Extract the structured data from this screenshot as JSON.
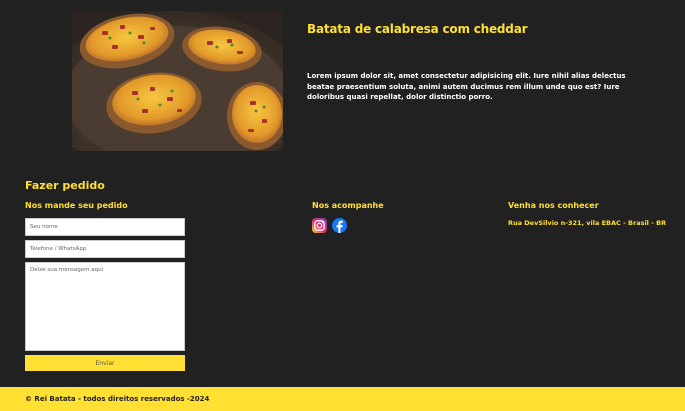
{
  "product": {
    "image_icon": "loaded-potato-photo",
    "title": "Batata de calabresa com cheddar",
    "description": "Lorem ipsum dolor sit, amet consectetur adipisicing elit. Iure nihil alias delectus beatae praesentium soluta, animi autem ducimus rem illum unde quo est? Iure doloribus quasi repellat, dolor distinctio porro."
  },
  "order": {
    "title": "Fazer pedido",
    "subtitle": "Nos mande seu pedido",
    "name_placeholder": "Seu nome",
    "phone_placeholder": "Telefone / WhatsApp",
    "message_placeholder": "Deixe sua mensagem aqui",
    "send_label": "Enviar"
  },
  "social": {
    "title": "Nos acompanhe",
    "icons": [
      "instagram-icon",
      "facebook-icon"
    ]
  },
  "visit": {
    "title": "Venha nos conhecer",
    "address": "Rua DevSilvio n-321, vila EBAC - Brasil - BR"
  },
  "footer": {
    "text": "© Rei Batata - todos direitos reservados -2024"
  },
  "colors": {
    "background": "#212121",
    "accent": "#FFE033"
  }
}
